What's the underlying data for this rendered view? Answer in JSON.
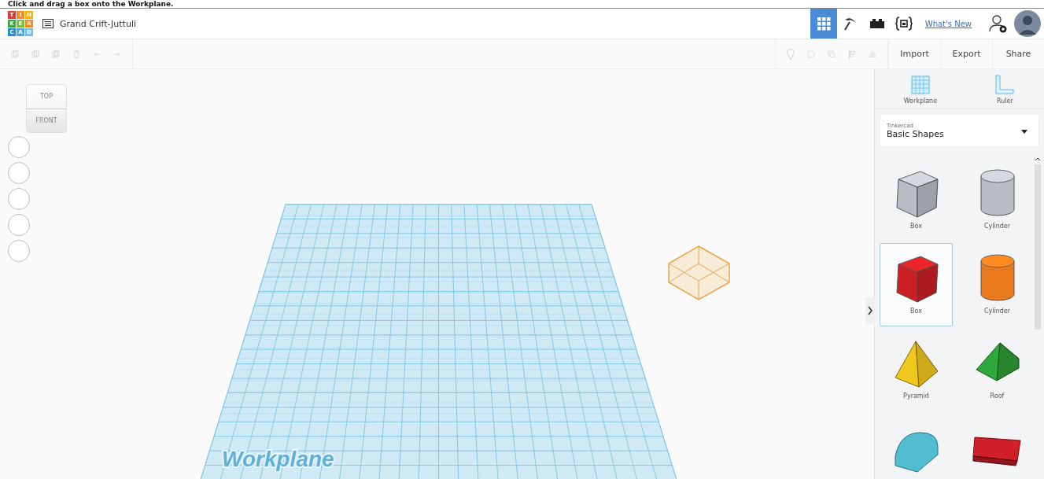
{
  "caption": "Click and drag a box onto the Workplane.",
  "header": {
    "logo_letters": [
      "T",
      "I",
      "N",
      "K",
      "E",
      "R",
      "C",
      "A",
      "D"
    ],
    "design_title": "Grand Crift-Juttuli",
    "views": [
      {
        "kind": "grid",
        "selected": true
      },
      {
        "kind": "tools",
        "selected": false
      },
      {
        "kind": "bricks",
        "selected": false
      },
      {
        "kind": "code",
        "selected": false
      }
    ],
    "whats_new": "What's New"
  },
  "toolbar": {
    "actions": [
      "Import",
      "Export",
      "Share"
    ]
  },
  "view_cube": {
    "top": "TOP",
    "front": "FRONT"
  },
  "canvas": {
    "workplane_label": "Workplane"
  },
  "panel": {
    "tools": [
      {
        "kind": "workplane",
        "label": "Workplane"
      },
      {
        "kind": "ruler",
        "label": "Ruler"
      }
    ],
    "library": {
      "caption": "Tinkercad",
      "value": "Basic Shapes"
    },
    "shapes": [
      {
        "kind": "box",
        "label": "Box",
        "color": "#b8bcc4",
        "selected": false
      },
      {
        "kind": "cylinder",
        "label": "Cylinder",
        "color": "#b8bcc4",
        "selected": false
      },
      {
        "kind": "box",
        "label": "Box",
        "color": "#cc1f24",
        "selected": true
      },
      {
        "kind": "cylinder",
        "label": "Cylinder",
        "color": "#e8791c",
        "selected": false
      },
      {
        "kind": "pyramid",
        "label": "Pyramid",
        "color": "#f0c81c",
        "selected": false
      },
      {
        "kind": "roof",
        "label": "Roof",
        "color": "#2ea83a",
        "selected": false
      },
      {
        "kind": "halfcyl",
        "color": "#4fbcd0",
        "selected": false
      },
      {
        "kind": "text",
        "color": "#d0202a",
        "selected": false
      }
    ]
  }
}
